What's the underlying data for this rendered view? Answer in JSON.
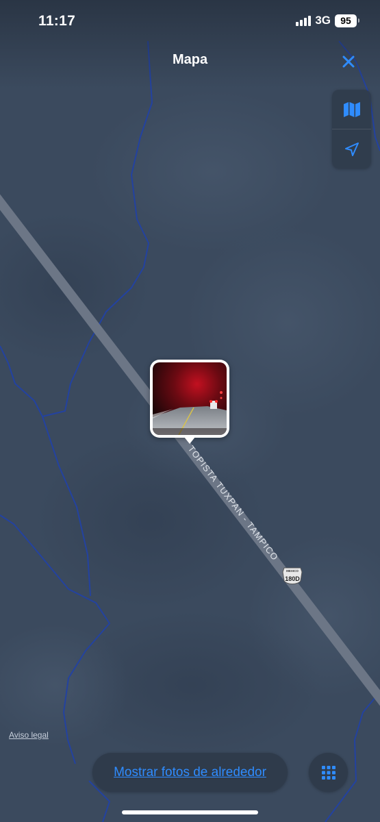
{
  "status_bar": {
    "time": "11:17",
    "network": "3G",
    "battery": "95"
  },
  "header": {
    "title": "Mapa",
    "close_icon": "close-icon"
  },
  "map_controls": {
    "map_mode_icon": "map-icon",
    "location_icon": "location-arrow-icon"
  },
  "map": {
    "road_label": "AUTOPISTA TUXPAN - TAMPICO",
    "road_label_visible": "TOPISTA TUXPAN - TAMPICO",
    "shield_country": "MEXICO",
    "shield_number": "180D",
    "colors": {
      "land": "#3b4a5e",
      "road": "#6c7686",
      "boundary": "#2342a0",
      "accent": "#2f8cff"
    }
  },
  "photo_pin": {
    "icon": "photo-thumbnail"
  },
  "footer": {
    "legal": "Aviso legal",
    "nearby_button": "Mostrar fotos de alrededor",
    "grid_icon": "grid-icon"
  }
}
